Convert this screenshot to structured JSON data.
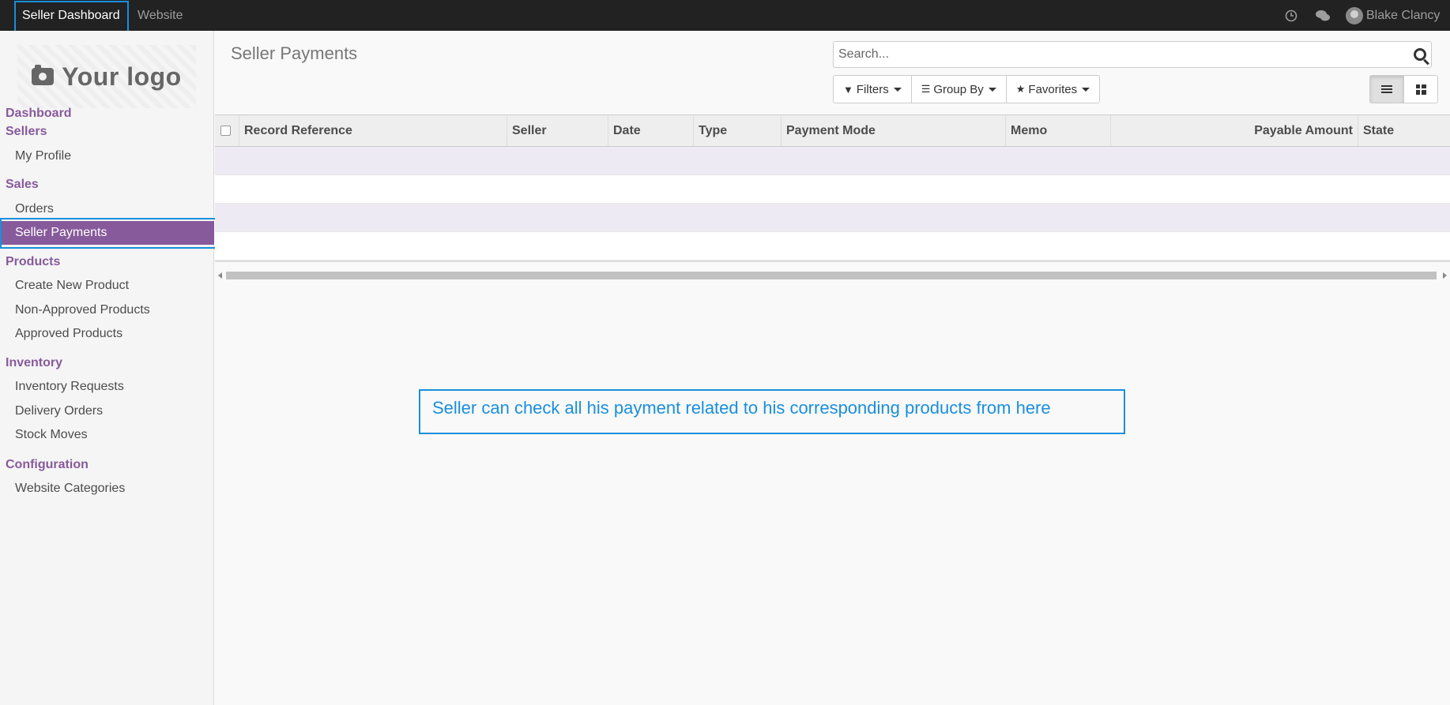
{
  "topbar": {
    "apps": [
      "Seller Dashboard",
      "Website"
    ],
    "user_name": "Blake Clancy"
  },
  "sidebar": {
    "logo_text": "Your logo",
    "dashboard": "Dashboard",
    "sellers": "Sellers",
    "my_profile": "My Profile",
    "sales": "Sales",
    "orders": "Orders",
    "seller_payments": "Seller Payments",
    "products": "Products",
    "create_new_product": "Create New Product",
    "non_approved_products": "Non-Approved Products",
    "approved_products": "Approved Products",
    "inventory": "Inventory",
    "inventory_requests": "Inventory Requests",
    "delivery_orders": "Delivery Orders",
    "stock_moves": "Stock Moves",
    "configuration": "Configuration",
    "website_categories": "Website Categories"
  },
  "main": {
    "title": "Seller Payments",
    "search_placeholder": "Search...",
    "filters_label": "Filters",
    "group_by_label": "Group By",
    "favorites_label": "Favorites"
  },
  "table": {
    "columns": [
      "Record Reference",
      "Seller",
      "Date",
      "Type",
      "Payment Mode",
      "Memo",
      "Payable Amount",
      "State"
    ],
    "rows": []
  },
  "annotation": {
    "text": "Seller can check all his payment related to his corresponding products from here",
    "color": "#1a8fdc"
  },
  "colors": {
    "accent": "#875a9b",
    "topbar": "#222222"
  }
}
